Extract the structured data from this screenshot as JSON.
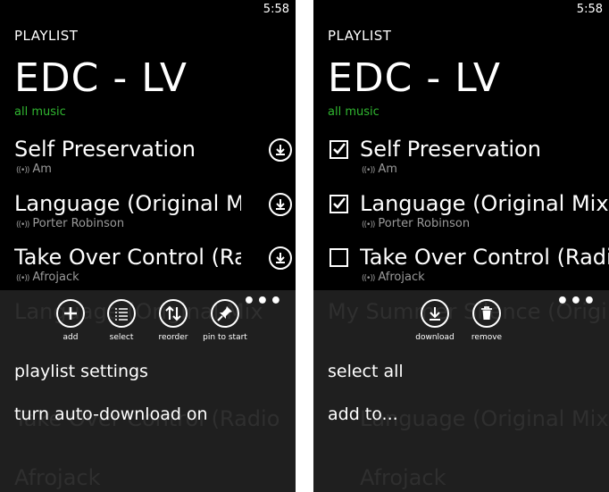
{
  "left": {
    "clock": "5:58",
    "heading": "PLAYLIST",
    "title": "EDC - LV",
    "pivot": "all music",
    "songs": [
      {
        "title": "Self Preservation",
        "artist": "Am"
      },
      {
        "title": "Language (Original Mix",
        "artist": "Porter Robinson"
      },
      {
        "title": "Take Over Control (Radio",
        "artist": "Afrojack"
      }
    ],
    "ghost_rows": [
      "Language (Original Mix",
      "Take Over Control (Radio",
      "Afrojack"
    ],
    "appbar": {
      "ellipsis": "•••",
      "buttons": [
        {
          "label": "add",
          "icon": "add-icon"
        },
        {
          "label": "select",
          "icon": "select-icon"
        },
        {
          "label": "reorder",
          "icon": "reorder-icon"
        },
        {
          "label": "pin to start",
          "icon": "pin-icon"
        }
      ],
      "menu": [
        "playlist settings",
        "turn auto-download on"
      ]
    }
  },
  "right": {
    "clock": "5:58",
    "heading": "PLAYLIST",
    "title": "EDC - LV",
    "pivot": "all music",
    "songs": [
      {
        "title": "Self Preservation",
        "artist": "Am",
        "checked": true
      },
      {
        "title": "Language (Original Mix)",
        "artist": "Porter Robinson",
        "checked": true
      },
      {
        "title": "Take Over Control (Radio",
        "artist": "Afrojack",
        "checked": false
      }
    ],
    "ghost_rows": [
      "My Summer Silence (Origi",
      "Language (Original Mix",
      "Afrojack"
    ],
    "appbar": {
      "ellipsis": "•••",
      "buttons": [
        {
          "label": "download",
          "icon": "download-icon"
        },
        {
          "label": "remove",
          "icon": "trash-icon"
        }
      ],
      "menu": [
        "select all",
        "add to..."
      ]
    }
  }
}
